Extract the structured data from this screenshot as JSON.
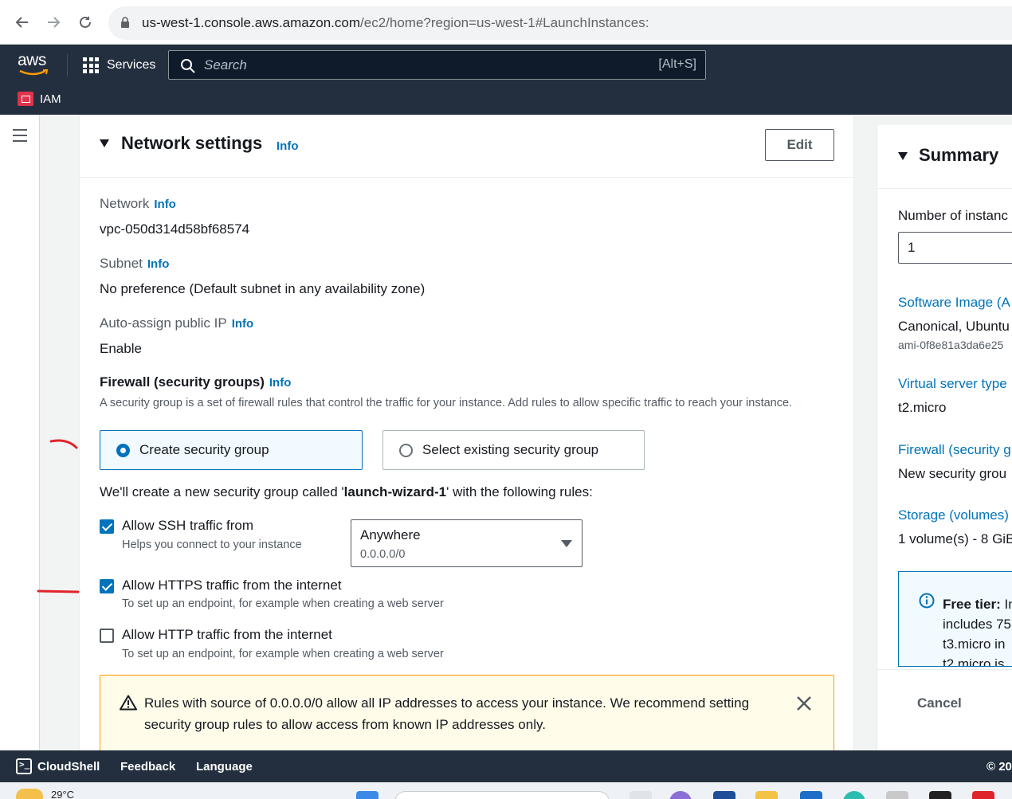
{
  "browser": {
    "url_host": "us-west-1.console.aws.amazon.com",
    "url_path": "/ec2/home?region=us-west-1#LaunchInstances:"
  },
  "header": {
    "logo_text": "aws",
    "services_label": "Services",
    "search_placeholder": "Search",
    "search_shortcut": "[Alt+S]",
    "favorite_label": "IAM"
  },
  "network_settings": {
    "title": "Network settings",
    "info": "Info",
    "edit_label": "Edit",
    "network_label": "Network",
    "network_value": "vpc-050d314d58bf68574",
    "subnet_label": "Subnet",
    "subnet_value": "No preference (Default subnet in any availability zone)",
    "public_ip_label": "Auto-assign public IP",
    "public_ip_value": "Enable",
    "firewall_heading": "Firewall (security groups)",
    "firewall_desc": "A security group is a set of firewall rules that control the traffic for your instance. Add rules to allow specific traffic to reach your instance.",
    "create_sg_label": "Create security group",
    "select_sg_label": "Select existing security group",
    "new_sg_prefix": "We'll create a new security group called '",
    "new_sg_name": "launch-wizard-1",
    "new_sg_suffix": "' with the following rules:",
    "rules": [
      {
        "label": "Allow SSH traffic from",
        "desc": "Helps you connect to your instance",
        "checked": true
      },
      {
        "label": "Allow HTTPS traffic from the internet",
        "desc": "To set up an endpoint, for example when creating a web server",
        "checked": true
      },
      {
        "label": "Allow HTTP traffic from the internet",
        "desc": "To set up an endpoint, for example when creating a web server",
        "checked": false
      }
    ],
    "ssh_source_value": "Anywhere",
    "ssh_source_sub": "0.0.0.0/0",
    "warning_text": "Rules with source of 0.0.0.0/0 allow all IP addresses to access your instance. We recommend setting security group rules to allow access from known IP addresses only."
  },
  "summary": {
    "title": "Summary",
    "num_instances_label": "Number of instanc",
    "num_instances_value": "1",
    "software_image_link": "Software Image (A",
    "software_image_value": "Canonical, Ubuntu",
    "software_image_ami": "ami-0f8e81a3da6e25",
    "server_type_link": "Virtual server type",
    "server_type_value": "t2.micro",
    "firewall_link": "Firewall (security g",
    "firewall_value": "New security grou",
    "storage_link": "Storage (volumes)",
    "storage_value": "1 volume(s) - 8 GiB",
    "free_tier_label": "Free tier:",
    "free_tier_line1": "In",
    "free_tier_line2": "includes 75",
    "free_tier_line3": "t3.micro in",
    "free_tier_line4": "t2.micro is",
    "cancel_label": "Cancel"
  },
  "footer": {
    "cloudshell_label": "CloudShell",
    "feedback_label": "Feedback",
    "language_label": "Language",
    "copyright": "© 20"
  },
  "taskbar": {
    "weather_temp": "29°C"
  },
  "colors": {
    "aws_header": "#232f3e",
    "accent_blue": "#0073bb",
    "annotation_red": "#e0242b",
    "warning_bg": "#fffce9"
  }
}
